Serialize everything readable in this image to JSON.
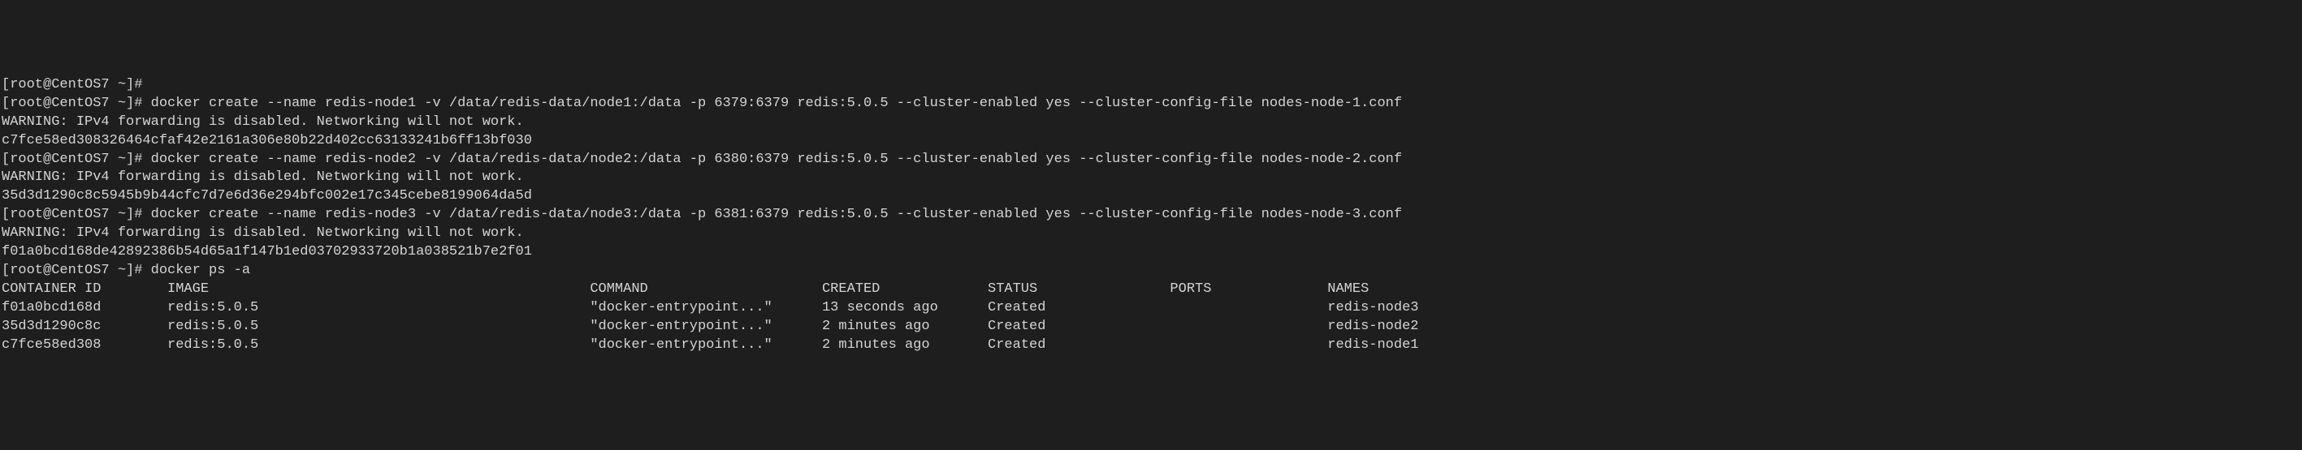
{
  "lines": [
    {
      "type": "prompt_only",
      "prompt": "[root@CentOS7 ~]#"
    },
    {
      "type": "command",
      "prompt": "[root@CentOS7 ~]#",
      "command": "docker create --name redis-node1 -v /data/redis-data/node1:/data -p 6379:6379 redis:5.0.5 --cluster-enabled yes --cluster-config-file nodes-node-1.conf"
    },
    {
      "type": "output",
      "text": "WARNING: IPv4 forwarding is disabled. Networking will not work."
    },
    {
      "type": "output",
      "text": "c7fce58ed308326464cfaf42e2161a306e80b22d402cc63133241b6ff13bf030"
    },
    {
      "type": "command",
      "prompt": "[root@CentOS7 ~]#",
      "command": "docker create --name redis-node2 -v /data/redis-data/node2:/data -p 6380:6379 redis:5.0.5 --cluster-enabled yes --cluster-config-file nodes-node-2.conf"
    },
    {
      "type": "output",
      "text": "WARNING: IPv4 forwarding is disabled. Networking will not work."
    },
    {
      "type": "output",
      "text": "35d3d1290c8c5945b9b44cfc7d7e6d36e294bfc002e17c345cebe8199064da5d"
    },
    {
      "type": "command",
      "prompt": "[root@CentOS7 ~]#",
      "command": "docker create --name redis-node3 -v /data/redis-data/node3:/data -p 6381:6379 redis:5.0.5 --cluster-enabled yes --cluster-config-file nodes-node-3.conf"
    },
    {
      "type": "output",
      "text": "WARNING: IPv4 forwarding is disabled. Networking will not work."
    },
    {
      "type": "output",
      "text": "f01a0bcd168de42892386b54d65a1f147b1ed03702933720b1a038521b7e2f01"
    },
    {
      "type": "command",
      "prompt": "[root@CentOS7 ~]#",
      "command": "docker ps -a"
    }
  ],
  "table": {
    "headers": {
      "container_id": "CONTAINER ID",
      "image": "IMAGE",
      "command": "COMMAND",
      "created": "CREATED",
      "status": "STATUS",
      "ports": "PORTS",
      "names": "NAMES"
    },
    "rows": [
      {
        "container_id": "f01a0bcd168d",
        "image": "redis:5.0.5",
        "command": "\"docker-entrypoint...\"",
        "created": "13 seconds ago",
        "status": "Created",
        "ports": "",
        "names": "redis-node3"
      },
      {
        "container_id": "35d3d1290c8c",
        "image": "redis:5.0.5",
        "command": "\"docker-entrypoint...\"",
        "created": "2 minutes ago",
        "status": "Created",
        "ports": "",
        "names": "redis-node2"
      },
      {
        "container_id": "c7fce58ed308",
        "image": "redis:5.0.5",
        "command": "\"docker-entrypoint...\"",
        "created": "2 minutes ago",
        "status": "Created",
        "ports": "",
        "names": "redis-node1"
      }
    ]
  }
}
